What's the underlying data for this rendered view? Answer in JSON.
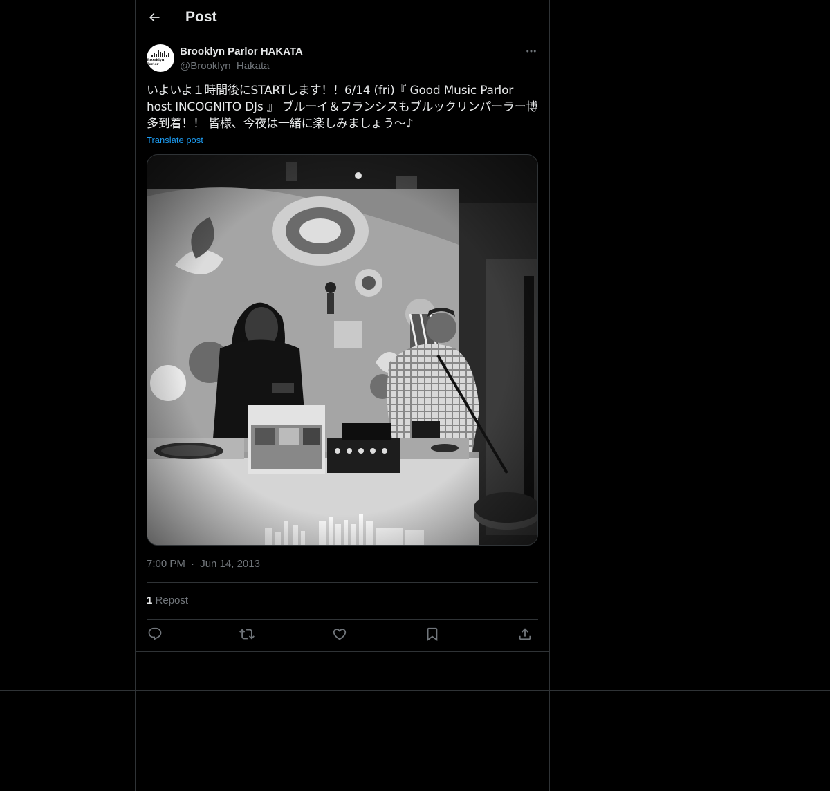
{
  "header": {
    "title": "Post"
  },
  "author": {
    "display_name": "Brooklyn Parlor HAKATA",
    "handle": "@Brooklyn_Hakata",
    "avatar_text": "Brooklyn Parlor"
  },
  "post": {
    "text": "いよいよ１時間後にSTARTします！！6/14 (fri)『 Good Music Parlor host INCOGNITO DJs 』 ブルーイ＆フランシスもブルックリンパーラー博多到着！！ 皆様、今夜は一緒に楽しみましょう〜♪",
    "translate_label": "Translate post",
    "time": "7:00 PM",
    "separator": "·",
    "date": "Jun 14, 2013"
  },
  "stats": {
    "repost_count": "1",
    "repost_label": "Repost"
  },
  "icons": {
    "back": "arrow-left-icon",
    "more": "more-horizontal-icon",
    "reply": "reply-icon",
    "repost": "repost-icon",
    "like": "heart-icon",
    "bookmark": "bookmark-icon",
    "share": "share-icon"
  },
  "colors": {
    "background": "#000000",
    "text": "#e7e9ea",
    "secondary": "#71767b",
    "link": "#1d9bf0",
    "border": "#2f3336"
  }
}
